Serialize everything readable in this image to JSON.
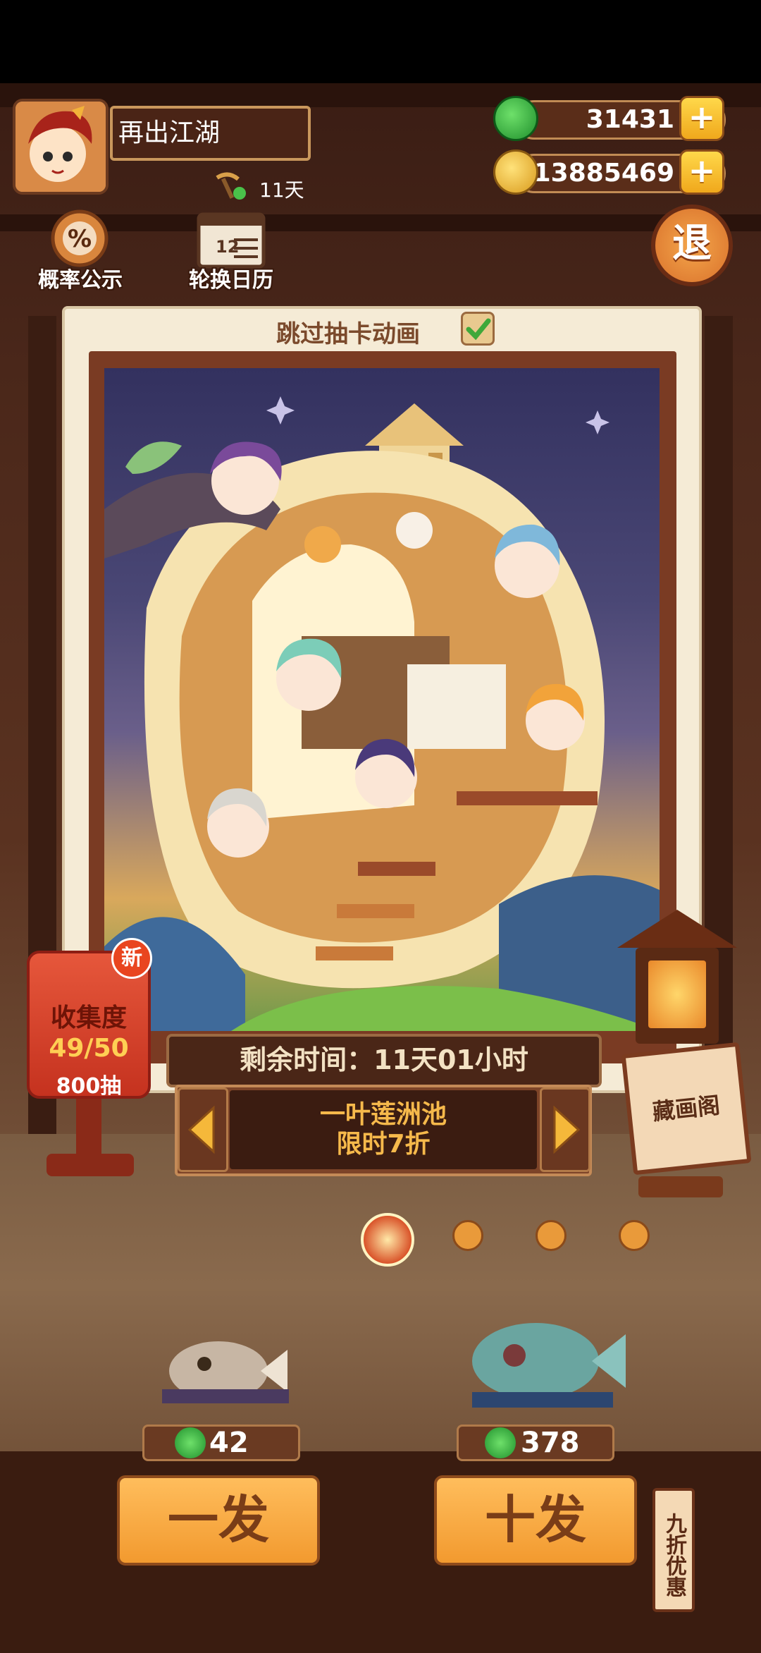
{
  "player": {
    "name": "再出江湖",
    "vip_days": "11天"
  },
  "currency": {
    "jade": "31431",
    "coins": "13885469"
  },
  "top_buttons": {
    "probability": "概率公示",
    "calendar": "轮换日历",
    "exit": "退"
  },
  "card": {
    "skip_label": "跳过抽卡动画",
    "skip_checked": true
  },
  "timer": {
    "label": "剩余时间：11天01小时"
  },
  "pool": {
    "line1": "一叶莲洲池",
    "line2": "限时7折"
  },
  "collection": {
    "title": "收集度",
    "progress": "49/50",
    "draws": "800抽",
    "badge": "新"
  },
  "gallery": {
    "label": "藏画阁"
  },
  "draw": {
    "single_cost": "42",
    "ten_cost": "378",
    "single_label": "一发",
    "ten_label": "十发",
    "discount": "九折优惠"
  },
  "colors": {
    "accent": "#f29a2f",
    "jade": "#2fa83a",
    "panel": "#4a2617"
  }
}
